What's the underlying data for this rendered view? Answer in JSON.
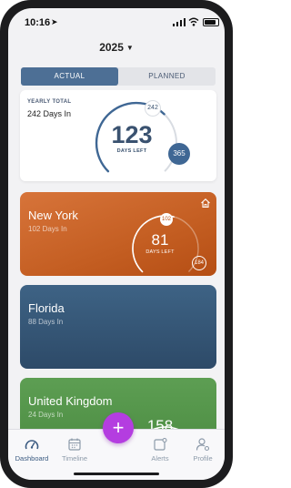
{
  "status_bar": {
    "time": "10:16",
    "location_icon": "location-arrow-icon"
  },
  "header": {
    "year": "2025",
    "dropdown_icon": "caret-down-icon"
  },
  "segment": {
    "options": [
      "ACTUAL",
      "PLANNED"
    ],
    "selected": "ACTUAL"
  },
  "yearly": {
    "label": "YEARLY TOTAL",
    "days_in": "242 Days In",
    "days_left": "123",
    "days_left_label": "DAYS LEFT",
    "marker_current": "242",
    "marker_total": "365",
    "progress_fraction": 0.663
  },
  "locations": [
    {
      "name": "New York",
      "days_in": "102 Days In",
      "days_left": "81",
      "days_left_label": "DAYS LEFT",
      "marker_current": "102",
      "marker_total": "184",
      "is_home": true,
      "progress_fraction": 0.554,
      "color": "#c45e22"
    },
    {
      "name": "Florida",
      "days_in": "88 Days In",
      "color": "#34536f"
    },
    {
      "name": "United Kingdom",
      "days_in": "24 Days In",
      "days_left": "158",
      "color": "#4e8f45"
    }
  ],
  "fab": {
    "label": "+"
  },
  "tabs": [
    {
      "label": "Dashboard",
      "icon": "dashboard-gauge-icon",
      "active": true
    },
    {
      "label": "Timeline",
      "icon": "calendar-icon",
      "active": false
    },
    {
      "label": "Alerts",
      "icon": "alerts-bell-icon",
      "active": false
    },
    {
      "label": "Profile",
      "icon": "profile-gear-icon",
      "active": false
    }
  ],
  "colors": {
    "accent": "#4d6f95",
    "fab": "#b43de0",
    "text_dark": "#3a5270"
  }
}
